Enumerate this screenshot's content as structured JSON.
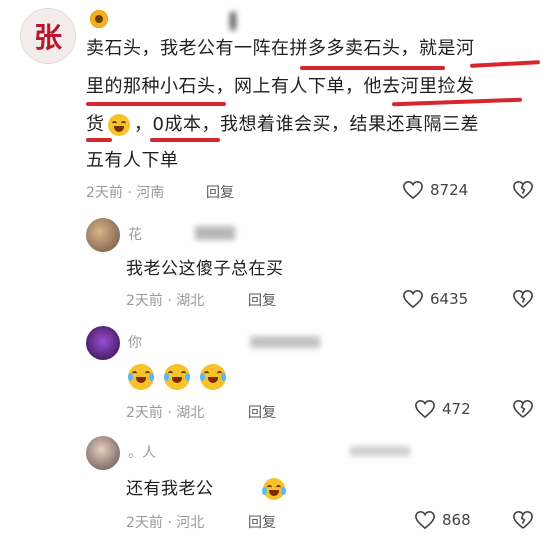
{
  "main_comment": {
    "avatar_text": "张",
    "text_lines": [
      "卖石头，我老公有一阵在拼多多卖石头，就是河",
      "里的那种小石头，网上有人下单，他去河里捡发",
      "货",
      "，0成本，我想着谁会买，结果还真隔三差",
      "五有人下单"
    ],
    "time": "2天前",
    "location": "河南",
    "reply_label": "回复",
    "likes": "8724"
  },
  "replies": [
    {
      "name": "花",
      "text": "我老公这傻子总在买",
      "time": "2天前",
      "location": "湖北",
      "reply_label": "回复",
      "likes": "6435"
    },
    {
      "name": "你",
      "text": "",
      "time": "2天前",
      "location": "湖北",
      "reply_label": "回复",
      "likes": "472"
    },
    {
      "name": "。人",
      "text": "还有我老公",
      "time": "2天前",
      "location": "河北",
      "reply_label": "回复",
      "likes": "868"
    }
  ],
  "colors": {
    "underline": "#d7262e",
    "meta": "#9a9a9a"
  }
}
